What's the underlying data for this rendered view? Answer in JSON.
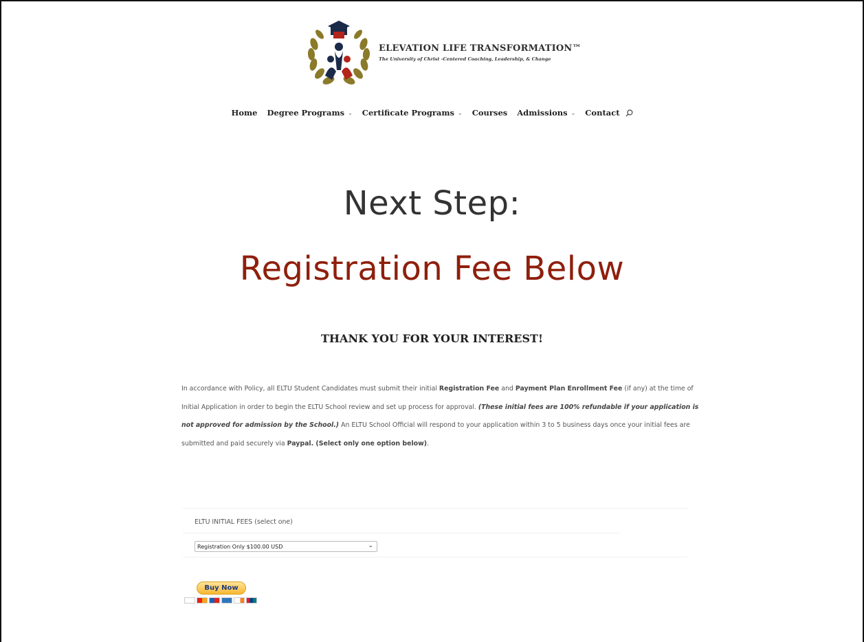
{
  "brand": {
    "name": "ELEVATION LIFE TRANSFORMATION™",
    "tagline": "The University of Christ -Centered Coaching, Leadership, & Change"
  },
  "nav": {
    "home": "Home",
    "degree": "Degree Programs",
    "certificate": "Certificate Programs",
    "courses": "Courses",
    "admissions": "Admissions",
    "contact": "Contact",
    "dropdown_glyph": "⌄"
  },
  "hero": {
    "line1": "Next Step:",
    "line2": "Registration Fee Below"
  },
  "thanks": "THANK YOU FOR YOUR INTEREST!",
  "policy": {
    "p1": "In accordance with Policy, all ELTU Student Candidates must submit their initial ",
    "b1": "Registration Fee",
    "p2": " and ",
    "b2": "Payment Plan Enrollment Fee",
    "p3": " (if any) at the time of Initial Application in order to begin the ELTU School review and set up process for approval.  ",
    "bi": "(These initial fees are 100% refundable if your application is not approved for admission by the School.)",
    "p4": " An ELTU School Official will respond to your application within 3 to 5 business days once your initial fees are submitted and paid securely via ",
    "b3": "Paypal. (Select only one option below)",
    "p5": "."
  },
  "fees": {
    "label": "ELTU INITIAL FEES (select one)",
    "selected": "Registration Only $100.00 USD",
    "arrow": "⌄"
  },
  "paypal": {
    "button": "Buy Now",
    "cards": [
      "visa",
      "mastercard",
      "maestro",
      "amex",
      "discover",
      "unionpay"
    ]
  },
  "colors": {
    "accent_red": "#8e1f0c",
    "gold": "#f7b830"
  }
}
